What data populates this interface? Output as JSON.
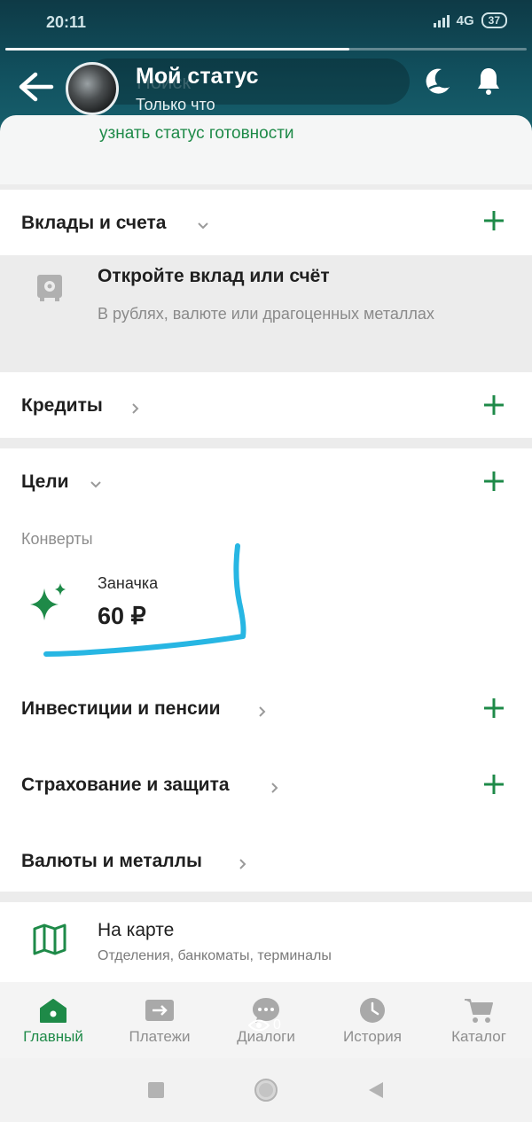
{
  "status_bar": {
    "time": "20:11",
    "network": "4G",
    "battery": "37"
  },
  "story": {
    "progress": 0.66,
    "search_placeholder": "Поиск",
    "title": "Мой статус",
    "time": "Только что"
  },
  "status_card": {
    "link": "узнать статус готовности"
  },
  "sections": {
    "deposits": {
      "title": "Вклады и счета",
      "promo_title": "Откройте вклад или счёт",
      "promo_subtitle": "В рублях, валюте или драгоценных металлах"
    },
    "credits": {
      "title": "Кредиты"
    },
    "goals": {
      "title": "Цели",
      "envelopes_label": "Конверты",
      "goal_name": "Заначка",
      "goal_amount": "60 ₽"
    },
    "investments": {
      "title": "Инвестиции и пенсии"
    },
    "insurance": {
      "title": "Страхование и защита"
    },
    "currency": {
      "title": "Валюты и металлы"
    }
  },
  "map": {
    "title": "На карте",
    "subtitle": "Отделения, банкоматы, терминалы"
  },
  "bottom_nav": {
    "items": [
      {
        "label": "Главный",
        "icon": "home-icon",
        "active": true
      },
      {
        "label": "Платежи",
        "icon": "payments-icon",
        "active": false
      },
      {
        "label": "Диалоги",
        "icon": "chat-icon",
        "active": false
      },
      {
        "label": "История",
        "icon": "clock-icon",
        "active": false
      },
      {
        "label": "Каталог",
        "icon": "cart-icon",
        "active": false
      }
    ],
    "views_count": "0"
  },
  "colors": {
    "accent": "#1e8a48",
    "header": "#11505e",
    "annotation": "#27b6e3"
  }
}
